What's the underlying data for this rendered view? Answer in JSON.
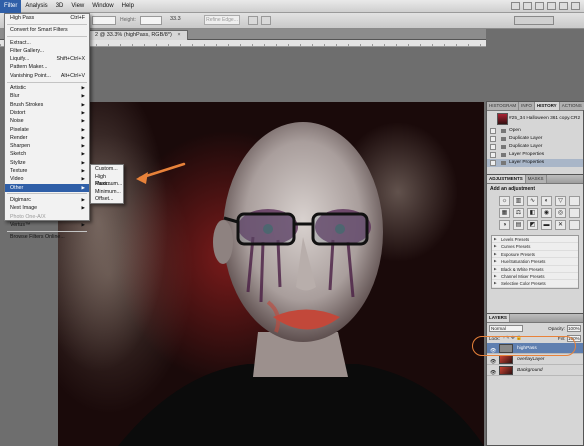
{
  "menubar": {
    "items": [
      "Filter",
      "Analysis",
      "3D",
      "View",
      "Window",
      "Help"
    ]
  },
  "options": {
    "zoom": "33.3",
    "height_label": "Height:",
    "refine_edge": "Refine Edge..."
  },
  "document": {
    "tab_title": "2 @ 33.3% (highPass, RGB/8*)",
    "tab_close": "×"
  },
  "filter_menu": {
    "last_filter": "High Pass",
    "last_filter_shortcut": "Ctrl+F",
    "convert_smart": "Convert for Smart Filters",
    "extract": "Extract...",
    "filter_gallery": "Filter Gallery...",
    "liquify": "Liquify...",
    "liquify_shortcut": "Shift+Ctrl+X",
    "pattern_maker": "Pattern Maker...",
    "vanishing_point": "Vanishing Point...",
    "vanishing_point_shortcut": "Alt+Ctrl+V",
    "categories": [
      "Artistic",
      "Blur",
      "Brush Strokes",
      "Distort",
      "Noise",
      "Pixelate",
      "Render",
      "Sharpen",
      "Sketch",
      "Stylize",
      "Texture",
      "Video",
      "Other"
    ],
    "plugins": [
      "Digimarc",
      "Next Image",
      "Photo One-A/X",
      "Vertus™"
    ],
    "browse_online": "Browse Filters Online..."
  },
  "other_submenu": [
    "Custom...",
    "High Pass...",
    "Maximum...",
    "Minimum...",
    "Offset..."
  ],
  "history_panel": {
    "tabs": [
      "HISTOGRAM",
      "INFO",
      "HISTORY",
      "ACTIONS"
    ],
    "snapshot": "#25_34 Halloween 361 copy.CR2",
    "states": [
      "Open",
      "Duplicate Layer",
      "Duplicate Layer",
      "Layer Properties",
      "Layer Properties"
    ]
  },
  "adjustments_panel": {
    "tabs": [
      "ADJUSTMENTS",
      "MASKS"
    ],
    "title": "Add an adjustment",
    "presets": [
      "Levels Presets",
      "Curves Presets",
      "Exposure Presets",
      "Hue/Saturation Presets",
      "Black & White Presets",
      "Channel Mixer Presets",
      "Selective Color Presets"
    ]
  },
  "layers_panel": {
    "tab": "LAYERS",
    "blend_mode": "Normal",
    "opacity_label": "Opacity:",
    "opacity": "100%",
    "fill_label": "Fill:",
    "fill": "100%",
    "lock_label": "Lock:",
    "layers": [
      "highPass",
      "overlayLayer",
      "Background"
    ]
  },
  "colors": {
    "highlight_blue": "#2f5fa8",
    "annotation_orange": "#e8823a"
  }
}
